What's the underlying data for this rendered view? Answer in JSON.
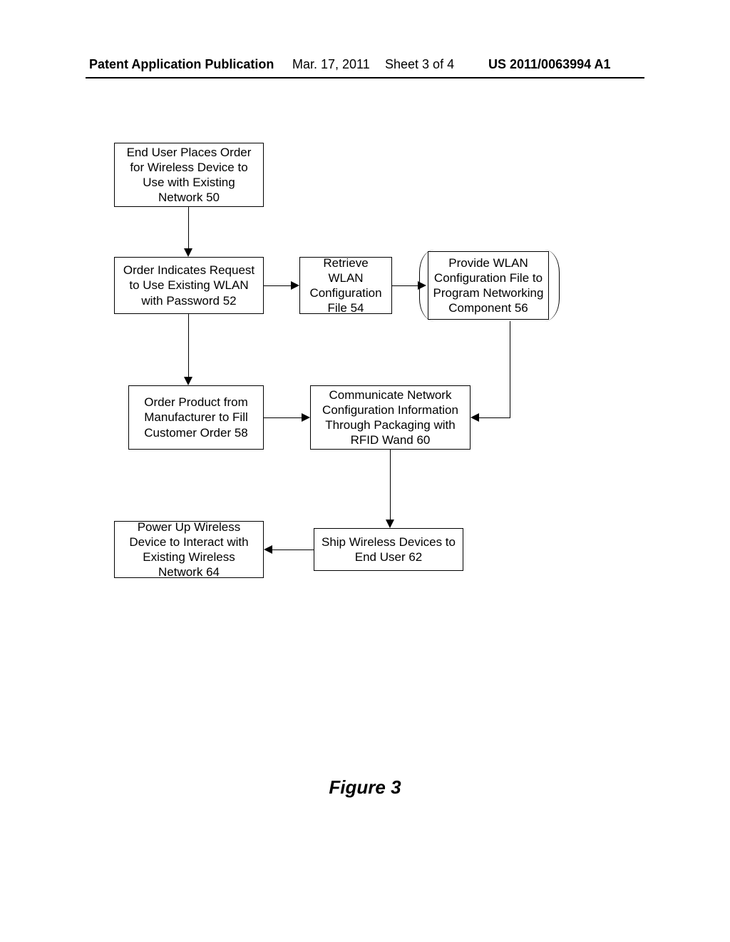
{
  "header": {
    "publication_label": "Patent Application Publication",
    "date": "Mar. 17, 2011",
    "sheet": "Sheet 3 of 4",
    "pub_number": "US 2011/0063994 A1"
  },
  "figure_label": "Figure 3",
  "boxes": {
    "b50": "End User Places Order for Wireless Device to Use with Existing Network 50",
    "b52": "Order Indicates Request to Use Existing WLAN with Password 52",
    "b54": "Retrieve WLAN Configuration File 54",
    "b56": "Provide WLAN Configuration File to Program Networking Component 56",
    "b58": "Order Product from Manufacturer to Fill Customer Order 58",
    "b60": "Communicate Network Configuration Information Through Packaging with RFID Wand 60",
    "b62": "Ship Wireless Devices to End User 62",
    "b64": "Power Up Wireless Device to Interact with Existing Wireless Network 64"
  },
  "chart_data": {
    "type": "flowchart",
    "nodes": [
      {
        "id": "50",
        "label": "End User Places Order for Wireless Device to Use with Existing Network 50"
      },
      {
        "id": "52",
        "label": "Order Indicates Request to Use Existing WLAN with Password 52"
      },
      {
        "id": "54",
        "label": "Retrieve WLAN Configuration File 54"
      },
      {
        "id": "56",
        "label": "Provide WLAN Configuration File to Program Networking Component 56"
      },
      {
        "id": "58",
        "label": "Order Product from Manufacturer to Fill Customer Order 58"
      },
      {
        "id": "60",
        "label": "Communicate Network Configuration Information Through Packaging with RFID Wand 60"
      },
      {
        "id": "62",
        "label": "Ship Wireless Devices to End User 62"
      },
      {
        "id": "64",
        "label": "Power Up Wireless Device to Interact with Existing Wireless Network 64"
      }
    ],
    "edges": [
      {
        "from": "50",
        "to": "52"
      },
      {
        "from": "52",
        "to": "54"
      },
      {
        "from": "54",
        "to": "56"
      },
      {
        "from": "52",
        "to": "58"
      },
      {
        "from": "58",
        "to": "60"
      },
      {
        "from": "56",
        "to": "60"
      },
      {
        "from": "60",
        "to": "62"
      },
      {
        "from": "62",
        "to": "64"
      }
    ]
  }
}
